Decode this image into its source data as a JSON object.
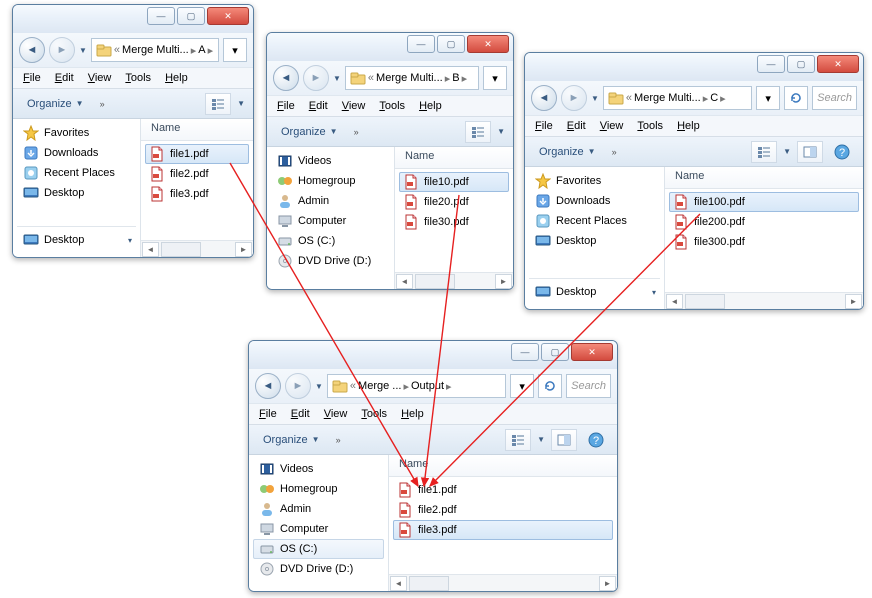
{
  "menus": {
    "file": "File",
    "edit": "Edit",
    "view": "View",
    "tools": "Tools",
    "help": "Help"
  },
  "org_label": "Organize",
  "column_header": "Name",
  "search_placeholder": "Search",
  "sidebar": {
    "favorites": "Favorites",
    "downloads": "Downloads",
    "recent": "Recent Places",
    "desktop": "Desktop",
    "videos": "Videos",
    "homegroup": "Homegroup",
    "admin": "Admin",
    "computer": "Computer",
    "osc": "OS (C:)",
    "dvd": "DVD Drive (D:)"
  },
  "winA": {
    "crumbs": {
      "a": "Merge Multi...",
      "b": "A"
    },
    "files": [
      "file1.pdf",
      "file2.pdf",
      "file3.pdf"
    ],
    "selected": 0
  },
  "winB": {
    "crumbs": {
      "a": "Merge Multi...",
      "b": "B"
    },
    "files": [
      "file10.pdf",
      "file20.pdf",
      "file30.pdf"
    ],
    "selected": 0
  },
  "winC": {
    "crumbs": {
      "a": "Merge Multi...",
      "b": "C"
    },
    "files": [
      "file100.pdf",
      "file200.pdf",
      "file300.pdf"
    ],
    "selected": 0
  },
  "winOut": {
    "crumbs": {
      "a": "Merge ...",
      "b": "Output"
    },
    "files": [
      "file1.pdf",
      "file2.pdf",
      "file3.pdf"
    ],
    "selected": 2
  }
}
